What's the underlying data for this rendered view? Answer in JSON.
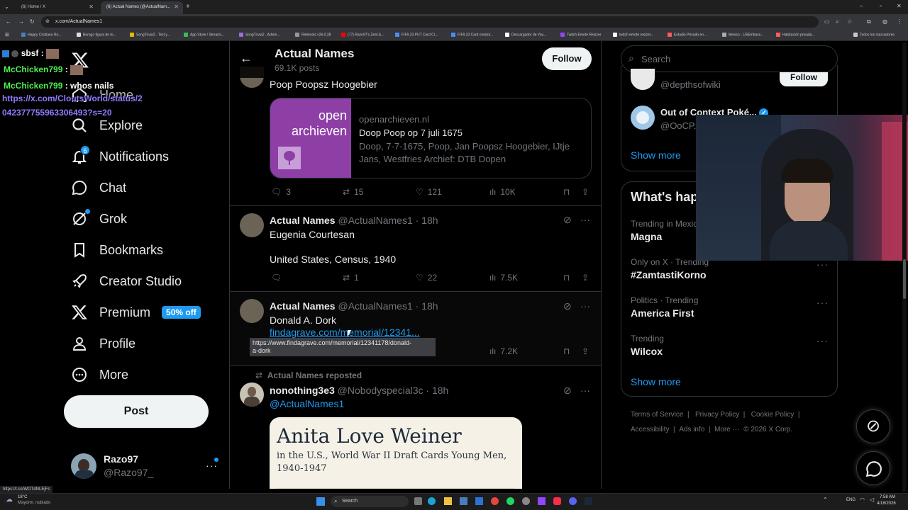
{
  "browser": {
    "tabs": [
      "(6) Home / X",
      "(6) Actual Names (@ActualNam..."
    ],
    "url": "x.com/ActualNames1",
    "bookmarks": [
      "Happy Cristiano Ro...",
      "Burago figura de to...",
      "SongTrivia2 - Test y...",
      "App Store / Streami...",
      "SongTrivia2 - Advim...",
      "Reletools v26.0.28",
      "(77) Razo97's Zeel-A...",
      "FIFA 23 PUT Card Cr...",
      "FIFA 23 Card creator...",
      "Descargador de You...",
      "Twitch Emote Resizer",
      "twitch emote resizer...",
      "Estudio Privado en...",
      "Mexico - USEmbass...",
      "Habitación privada...",
      "Todos los marcadores"
    ]
  },
  "chat": [
    {
      "user": "sbsf",
      "sep": " :",
      "msg": ""
    },
    {
      "user": "McChicken799",
      "sep": " :",
      "msg": ""
    },
    {
      "user": "McChicken799",
      "sep": " :",
      "msg": " whos nails"
    }
  ],
  "chat_link": [
    "https://x.com/CloutsWorld/status/2",
    "042377755963306493?s=20"
  ],
  "nav": {
    "home": "Home",
    "explore": "Explore",
    "notifications": "Notifications",
    "notifications_badge": "6",
    "chat": "Chat",
    "grok": "Grok",
    "bookmarks": "Bookmarks",
    "creator_studio": "Creator Studio",
    "premium": "Premium",
    "premium_badge": "50% off",
    "profile": "Profile",
    "more": "More",
    "post_button": "Post",
    "account_name": "Razo97",
    "account_handle": "@Razo97_"
  },
  "header": {
    "title": "Actual Names",
    "post_count": "69.1K posts",
    "follow": "Follow"
  },
  "post1": {
    "text": "Poop Poopsz Hoogebier",
    "card_logo_top": "open",
    "card_logo_bottom": "archieven",
    "card_domain": "openarchieven.nl",
    "card_title": "Doop Poop op 7 juli 1675",
    "card_desc_1": "Doop, 7-7-1675, Poop, Jan Poopsz Hoogebier, IJtje",
    "card_desc_2": "Jans, Westfries Archief: DTB Dopen",
    "replies": "3",
    "reposts": "15",
    "likes": "121",
    "views": "10K"
  },
  "post2": {
    "name": "Actual Names",
    "handle": "@ActualNames1 · 18h",
    "line1": "Eugenia Courtesan",
    "line2": "United States, Census, 1940",
    "replies": "",
    "reposts": "1",
    "likes": "22",
    "views": "7.5K"
  },
  "post3": {
    "name": "Actual Names",
    "handle": "@ActualNames1 · 18h",
    "line1": "Donald A. Dork",
    "link": "findagrave.com/memorial/12341...",
    "tooltip_1": "https://www.findagrave.com/memorial/12341178/donald-",
    "tooltip_2": "a-dork",
    "views": "7.2K"
  },
  "post4": {
    "repost_label": "Actual Names reposted",
    "name": "nonothing3e3",
    "handle": "@Nobodyspecial3c · 18h",
    "mention": "@ActualNames1",
    "image_title": "Anita Love Weiner",
    "image_sub_1": "in the U.S., World War II Draft Cards Young Men,",
    "image_sub_2": "1940-1947"
  },
  "right": {
    "search_placeholder": "Search",
    "who1_handle": "@depthsofwiki",
    "who1_follow": "Follow",
    "who2_name": "Out of Context Poké...",
    "who2_handle": "@OoCP...",
    "show_more": "Show more",
    "whats_happening": "What's hap",
    "trends": [
      {
        "cat": "Trending in Mexic",
        "name": "Magna"
      },
      {
        "cat": "Only on X · Trending",
        "name": "#ZamtastiKorno"
      },
      {
        "cat": "Politics · Trending",
        "name": "America First"
      },
      {
        "cat": "Trending",
        "name": "Wilcox"
      }
    ],
    "show_more_2": "Show more",
    "footer_1": [
      "Terms of Service",
      "|",
      "Privacy Policy",
      "|",
      "Cookie Policy",
      "|"
    ],
    "footer_2": [
      "Accessibility",
      "|",
      "Ads info",
      "|",
      "More ···",
      "© 2026 X Corp."
    ]
  },
  "status_url": "https://t.co/WOTdNLEjFc",
  "taskbar": {
    "weather_temp": "18°C",
    "weather_desc": "Mayorm. nublado",
    "search": "Search",
    "lang": "ENG",
    "time": "7:58 AM",
    "date": "4/18/2026"
  },
  "colors": {
    "accent": "#1d9bf0",
    "chat_green": "#4ef04e",
    "chat_link": "#8f7cff",
    "card_purple": "#8e3fa6"
  }
}
